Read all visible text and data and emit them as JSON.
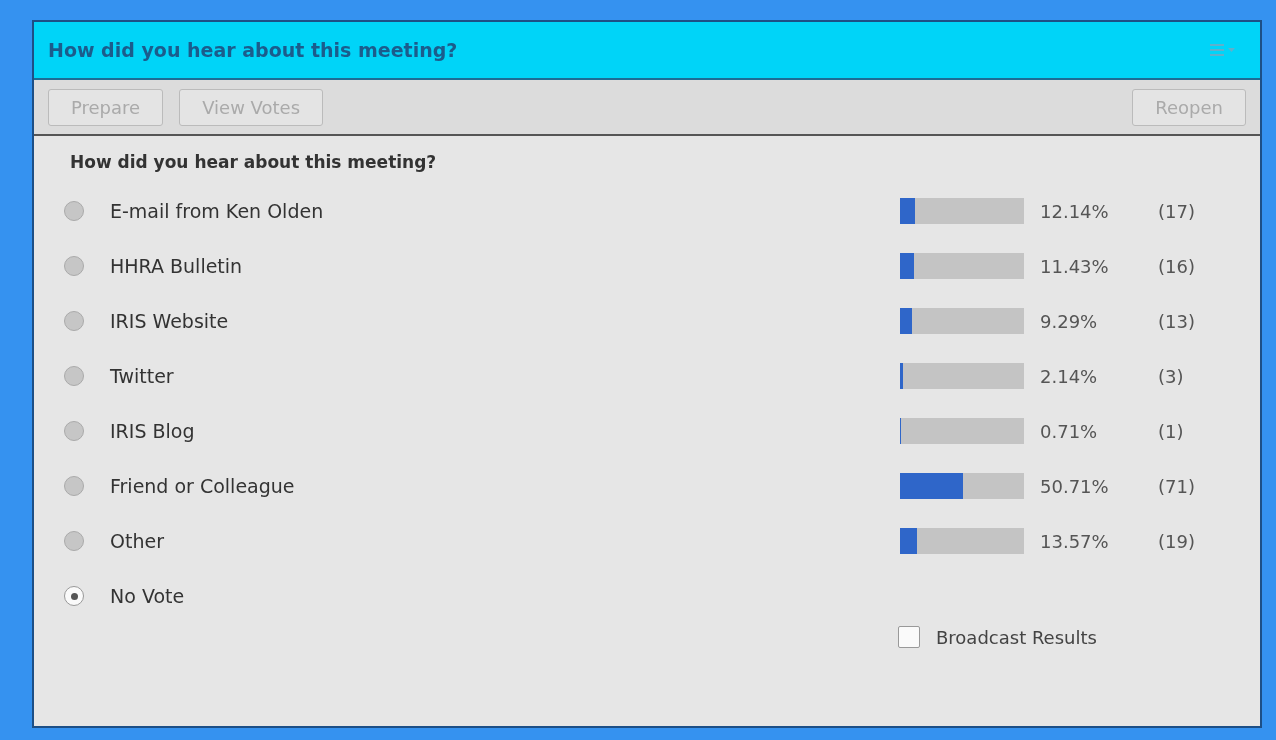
{
  "window": {
    "title": "How did you hear about this meeting?"
  },
  "toolbar": {
    "left_buttons": [
      {
        "label": "Prepare",
        "disabled": true
      },
      {
        "label": "View Votes",
        "disabled": true
      }
    ],
    "right_buttons": [
      {
        "label": "Reopen",
        "disabled": true
      }
    ]
  },
  "question": "How did you hear about this meeting?",
  "options": [
    {
      "label": "E-mail from Ken Olden",
      "selected": false,
      "level": 0.1214,
      "percent": "12.14%",
      "count": "(17)"
    },
    {
      "label": "HHRA Bulletin",
      "selected": false,
      "level": 0.1143,
      "percent": "11.43%",
      "count": "(16)"
    },
    {
      "label": "IRIS Website",
      "selected": false,
      "level": 0.0929,
      "percent": "9.29%",
      "count": "(13)"
    },
    {
      "label": "Twitter",
      "selected": false,
      "level": 0.0214,
      "percent": "2.14%",
      "count": "(3)"
    },
    {
      "label": "IRIS Blog",
      "selected": false,
      "level": 0.0071,
      "percent": "0.71%",
      "count": "(1)"
    },
    {
      "label": "Friend or Colleague",
      "selected": false,
      "level": 0.5071,
      "percent": "50.71%",
      "count": "(71)"
    },
    {
      "label": "Other",
      "selected": false,
      "level": 0.1357,
      "percent": "13.57%",
      "count": "(19)"
    },
    {
      "label": "No Vote",
      "selected": true
    }
  ],
  "broadcast": {
    "label": "Broadcast Results",
    "checked": false
  }
}
